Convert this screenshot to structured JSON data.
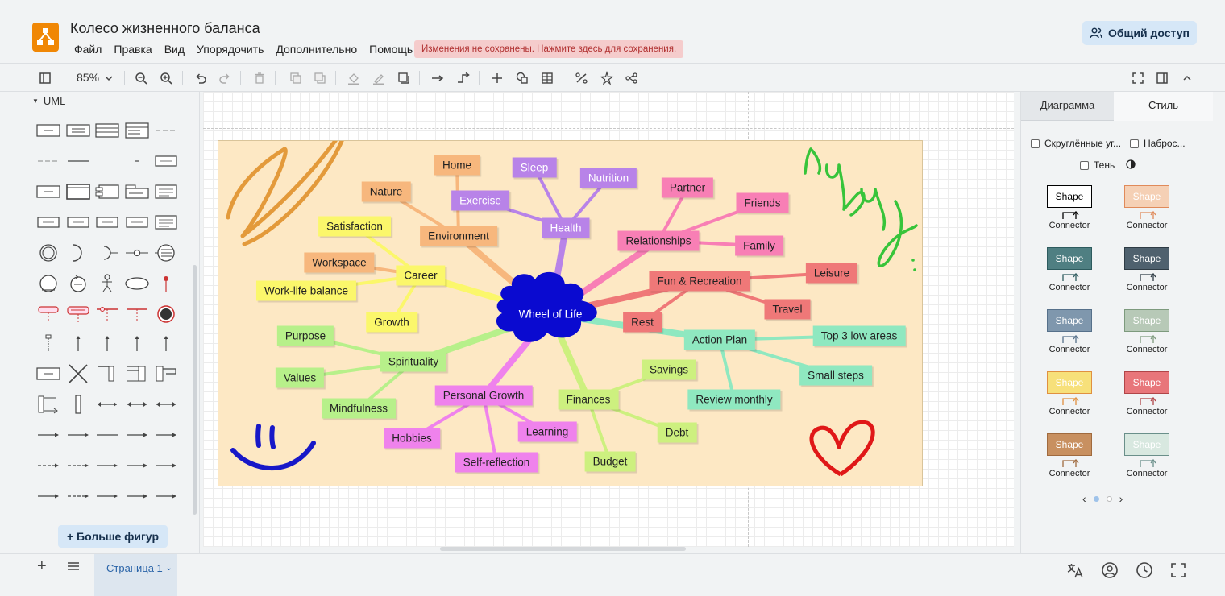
{
  "app": {
    "title": "Колесо жизненного баланса",
    "menu": [
      "Файл",
      "Правка",
      "Вид",
      "Упорядочить",
      "Дополнительно",
      "Помощь"
    ],
    "unsaved_notice": "Изменения не сохранены. Нажмите здесь для сохранения.",
    "share_label": "Общий доступ"
  },
  "toolbar": {
    "zoom": "85%",
    "icons": [
      "sidebar-toggle-icon",
      "zoom-dropdown-icon",
      "zoom-out-icon",
      "zoom-in-icon",
      "undo-icon",
      "redo-icon",
      "delete-icon",
      "to-front-icon",
      "to-back-icon",
      "fill-color-icon",
      "line-color-icon",
      "shadow-icon",
      "connection-icon",
      "waypoints-icon",
      "insert-icon",
      "shapes-icon",
      "table-icon",
      "format-icon",
      "edit-style-icon",
      "layout-icon",
      "fullscreen-icon",
      "format-panel-icon",
      "collapse-icon"
    ]
  },
  "left_panel": {
    "section": "UML",
    "more_shapes": "+ Больше фигур"
  },
  "mindmap": {
    "center": "Wheel of Life",
    "center_color": "#0a0ad0",
    "nodes": [
      {
        "label": "Home",
        "color": "#f7b77d"
      },
      {
        "label": "Nature",
        "color": "#f7b77d"
      },
      {
        "label": "Exercise",
        "color": "#b883e8"
      },
      {
        "label": "Sleep",
        "color": "#b883e8"
      },
      {
        "label": "Nutrition",
        "color": "#b883e8"
      },
      {
        "label": "Health",
        "color": "#b883e8"
      },
      {
        "label": "Environment",
        "color": "#f7b77d"
      },
      {
        "label": "Satisfaction",
        "color": "#fbf76b"
      },
      {
        "label": "Workspace",
        "color": "#f7b77d"
      },
      {
        "label": "Career",
        "color": "#fbf76b"
      },
      {
        "label": "Work-life balance",
        "color": "#fbf76b"
      },
      {
        "label": "Growth",
        "color": "#fbf76b"
      },
      {
        "label": "Partner",
        "color": "#f87fb5"
      },
      {
        "label": "Friends",
        "color": "#f87fb5"
      },
      {
        "label": "Relationships",
        "color": "#f87fb5"
      },
      {
        "label": "Family",
        "color": "#f87fb5"
      },
      {
        "label": "Fun & Recreation",
        "color": "#ef7878"
      },
      {
        "label": "Leisure",
        "color": "#ef7878"
      },
      {
        "label": "Travel",
        "color": "#ef7878"
      },
      {
        "label": "Rest",
        "color": "#ef7878"
      },
      {
        "label": "Action Plan",
        "color": "#8fe8c0"
      },
      {
        "label": "Top 3 low areas",
        "color": "#8fe8c0"
      },
      {
        "label": "Small steps",
        "color": "#8fe8c0"
      },
      {
        "label": "Review monthly",
        "color": "#8fe8c0"
      },
      {
        "label": "Purpose",
        "color": "#b7f08a"
      },
      {
        "label": "Spirituality",
        "color": "#b7f08a"
      },
      {
        "label": "Values",
        "color": "#b7f08a"
      },
      {
        "label": "Mindfulness",
        "color": "#b7f08a"
      },
      {
        "label": "Savings",
        "color": "#cdf07f"
      },
      {
        "label": "Finances",
        "color": "#cdf07f"
      },
      {
        "label": "Debt",
        "color": "#cdf07f"
      },
      {
        "label": "Budget",
        "color": "#cdf07f"
      },
      {
        "label": "Personal Growth",
        "color": "#ef82ec"
      },
      {
        "label": "Learning",
        "color": "#ef82ec"
      },
      {
        "label": "Hobbies",
        "color": "#ef82ec"
      },
      {
        "label": "Self-reflection",
        "color": "#ef82ec"
      }
    ],
    "handwriting": "пупупу"
  },
  "right_panel": {
    "tab_diagram": "Диаграмма",
    "tab_style": "Стиль",
    "opt_rounded": "Скруглённые уг...",
    "opt_sketch": "Наброс...",
    "opt_shadow": "Тень",
    "shape_label": "Shape",
    "connector_label": "Connector",
    "styles": [
      {
        "fill": "#ffffff",
        "stroke": "#000000",
        "text": "#000000"
      },
      {
        "fill": "#f5d0b5",
        "stroke": "#e08a5a",
        "text": "#ffffff"
      },
      {
        "fill": "#4f7f82",
        "stroke": "#2d5b5e",
        "text": "#ffffff"
      },
      {
        "fill": "#4f616e",
        "stroke": "#2e3b44",
        "text": "#ffffff"
      },
      {
        "fill": "#7f97ad",
        "stroke": "#56708a",
        "text": "#ffffff"
      },
      {
        "fill": "#b7c9b7",
        "stroke": "#7d9a7d",
        "text": "#ffffff"
      },
      {
        "fill": "#f7e07a",
        "stroke": "#e09040",
        "text": "#ffffff"
      },
      {
        "fill": "#e8767a",
        "stroke": "#b04548",
        "text": "#ffffff"
      },
      {
        "fill": "#c89060",
        "stroke": "#a06a3e",
        "text": "#ffffff"
      },
      {
        "fill": "#d8e8e0",
        "stroke": "#6a8f8a",
        "text": "#ffffff"
      }
    ]
  },
  "footer": {
    "page_tab": "Страница 1",
    "icons": [
      "add-page-icon",
      "pages-menu-icon",
      "translate-icon",
      "account-icon",
      "history-icon",
      "fullscreen-icon"
    ]
  }
}
